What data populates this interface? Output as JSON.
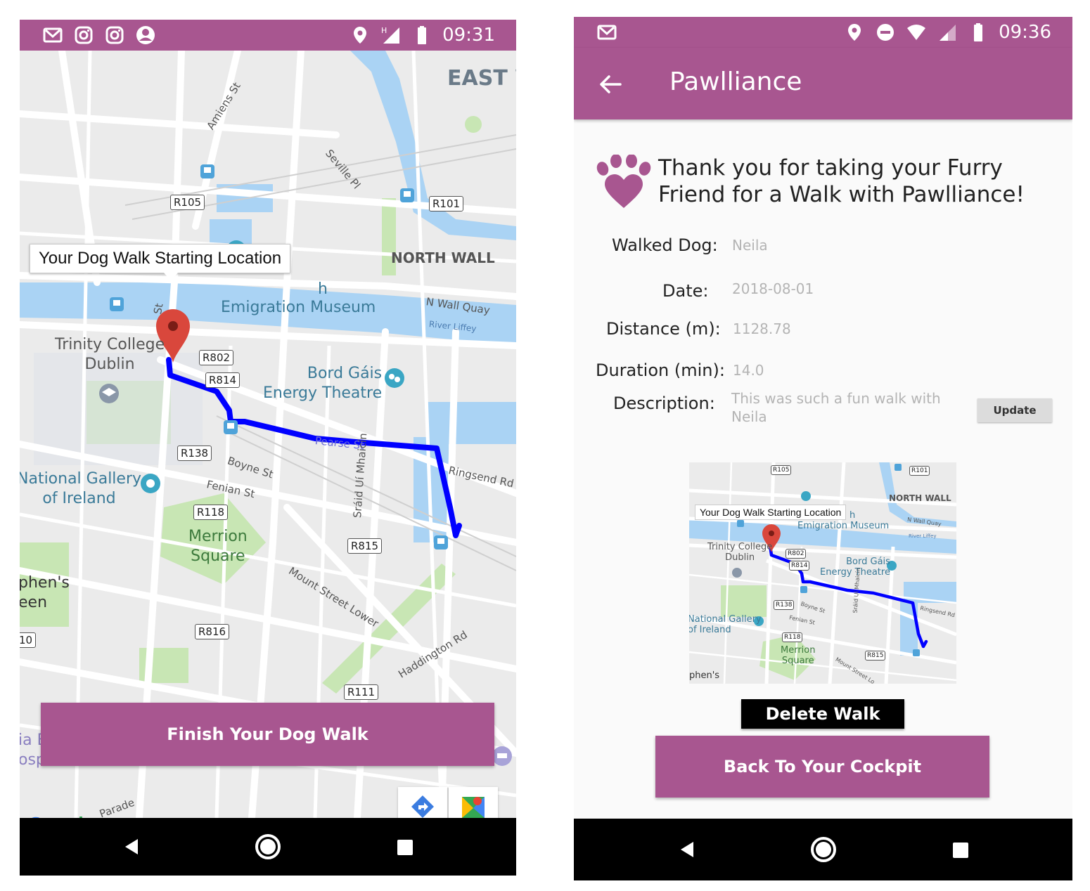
{
  "colors": {
    "brand": "#a85690",
    "route": "#0000ff",
    "marker": "#d9473c",
    "water": "#aad3f4",
    "park": "#c8e6b4"
  },
  "left": {
    "status": {
      "time": "09:31",
      "left_icons": [
        "gmail-icon",
        "instagram-icon",
        "instagram-icon",
        "account-circle-icon"
      ],
      "right_icons": [
        "location-icon",
        "signal-h-icon",
        "battery-icon"
      ]
    },
    "map": {
      "info_window": "Your Dog Walk Starting Location",
      "labels": {
        "east": "EAST W",
        "north_wall": "NORTH WALL",
        "emigration": "Emigration Museum",
        "emig_h": "h",
        "trinity": "Trinity College\nDublin",
        "bord": "Bord Gáis\nEnergy Theatre",
        "gallery": "National Gallery\nof Ireland",
        "merrion": "Merrion\nSquare",
        "stephens": "phen's\neen",
        "ia": "ia E\nosp",
        "ten": "10"
      },
      "streets": {
        "amiens": "Amiens St",
        "seville": "Seville Pl",
        "nwallquay": "N Wall Quay",
        "liffey": "River Liffey",
        "pearse": "Pearse St",
        "ringsend": "Ringsend Rd",
        "boyne": "Boyne St",
        "fenian": "Fenian St",
        "mhaicin": "Sráid Uí Mhaicín",
        "mountst": "Mount Street Lower",
        "haddington": "Haddington Rd",
        "parade": "Parade",
        "pl": "Pl",
        "st": "St"
      },
      "shields": {
        "r105": "R105",
        "r101": "R101",
        "r802": "R802",
        "r814": "R814",
        "r138": "R138",
        "r118": "R118",
        "r815": "R815",
        "r816": "R816",
        "r111": "R111"
      },
      "google": "Google"
    },
    "finish_button": "Finish Your Dog Walk"
  },
  "right": {
    "status": {
      "time": "09:36",
      "left_icons": [
        "gmail-icon"
      ],
      "right_icons": [
        "location-icon",
        "dnd-icon",
        "wifi-icon",
        "signal-icon",
        "battery-icon"
      ]
    },
    "appbar_title": "Pawlliance",
    "thanks_line1": "Thank you for taking your Furry",
    "thanks_line2": "Friend for a Walk with Pawlliance!",
    "fields": {
      "dog_label": "Walked Dog:",
      "dog_value": "Neila",
      "date_label": "Date:",
      "date_value": "2018-08-01",
      "distance_label": "Distance (m):",
      "distance_value": "1128.78",
      "duration_label": "Duration (min):",
      "duration_value": "14.0",
      "description_label": "Description:",
      "description_value": "This was such a fun walk with Neila"
    },
    "update_button": "Update",
    "thumbnail": {
      "info_window": "Your Dog Walk Starting Location",
      "north_wall": "NORTH WALL",
      "emigration": "Emigration Museum",
      "emig_h": "h",
      "trinity": "Trinity College\nDublin",
      "bord": "Bord Gáis\nEnergy Theatre",
      "gallery": "National Gallery\nof Ireland",
      "merrion": "Merrion\nSquare",
      "stephens": "phen's",
      "nwallquay": "N Wall Quay",
      "liffey": "River Liffey",
      "ringsend": "Ringsend Rd",
      "boyne": "Boyne St",
      "fenian": "Fenian St",
      "mountst": "Mount Street Lo",
      "mhaicin": "Sráid Uí Mhaicín",
      "r105": "R105",
      "r101": "R101",
      "r802": "R802",
      "r814": "R814",
      "r138": "R138",
      "r118": "R118",
      "r815": "R815"
    },
    "delete_button": "Delete Walk",
    "cockpit_button": "Back To Your Cockpit"
  }
}
